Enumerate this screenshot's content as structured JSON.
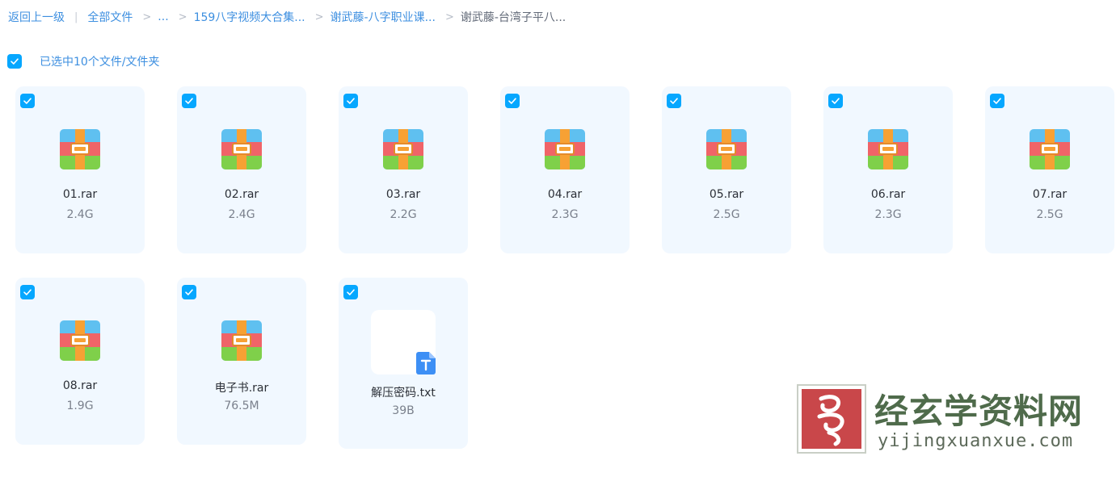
{
  "breadcrumb": {
    "back": "返回上一级",
    "root": "全部文件",
    "ellipsis": "...",
    "level1": "159八字视频大合集...",
    "level2": "谢武藤-八字职业课...",
    "current": "谢武藤-台湾子平八..."
  },
  "selection": {
    "text": "已选中10个文件/文件夹"
  },
  "files": [
    {
      "name": "01.rar",
      "size": "2.4G",
      "type": "rar"
    },
    {
      "name": "02.rar",
      "size": "2.4G",
      "type": "rar"
    },
    {
      "name": "03.rar",
      "size": "2.2G",
      "type": "rar"
    },
    {
      "name": "04.rar",
      "size": "2.3G",
      "type": "rar"
    },
    {
      "name": "05.rar",
      "size": "2.5G",
      "type": "rar"
    },
    {
      "name": "06.rar",
      "size": "2.3G",
      "type": "rar"
    },
    {
      "name": "07.rar",
      "size": "2.5G",
      "type": "rar"
    },
    {
      "name": "08.rar",
      "size": "1.9G",
      "type": "rar"
    },
    {
      "name": "电子书.rar",
      "size": "76.5M",
      "type": "rar"
    },
    {
      "name": "解压密码.txt",
      "size": "39B",
      "type": "txt"
    }
  ],
  "watermark": {
    "name": "经玄学资料网",
    "url": "yijingxuanxue.com"
  },
  "colors": {
    "accent": "#06a7ff",
    "link": "#3d8fe0",
    "card_bg": "#f1f8ff"
  },
  "icons": {
    "checkbox": "check-icon",
    "rar": "rar-archive-icon",
    "txt": "text-file-icon"
  }
}
